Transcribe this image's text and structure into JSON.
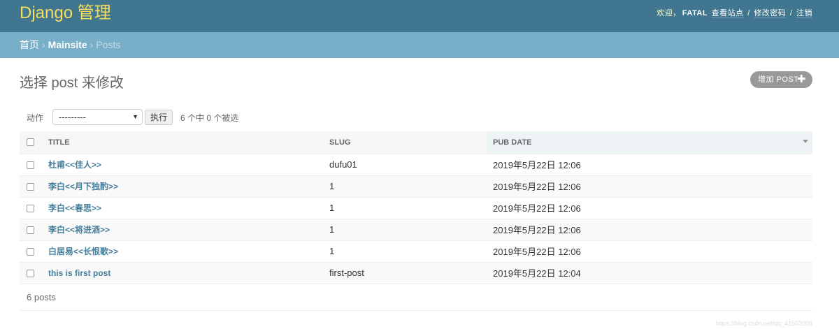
{
  "header": {
    "title": "Django 管理",
    "welcome": "欢迎，",
    "username": "FATAL",
    "links": [
      "查看站点",
      "修改密码",
      "注销"
    ],
    "separator": "/"
  },
  "breadcrumbs": {
    "items": [
      "首页",
      "Mainsite",
      "Posts"
    ],
    "separator": "›"
  },
  "page": {
    "title": "选择 post 来修改",
    "add_button": "增加 POST",
    "add_icon": "plus-icon"
  },
  "actions": {
    "label": "动作",
    "select_value": "---------",
    "go_button": "执行",
    "counter": "6 个中 0 个被选"
  },
  "table": {
    "columns": [
      "TITLE",
      "SLUG",
      "PUB DATE"
    ],
    "rows": [
      {
        "title": "杜甫<<佳人>>",
        "slug": "dufu01",
        "pub_date": "2019年5月22日 12:06"
      },
      {
        "title": "李白<<月下独酌>>",
        "slug": "1",
        "pub_date": "2019年5月22日 12:06"
      },
      {
        "title": "李白<<春思>>",
        "slug": "1",
        "pub_date": "2019年5月22日 12:06"
      },
      {
        "title": "李白<<将进酒>>",
        "slug": "1",
        "pub_date": "2019年5月22日 12:06"
      },
      {
        "title": "白居易<<长恨歌>>",
        "slug": "1",
        "pub_date": "2019年5月22日 12:06"
      },
      {
        "title": "this is first post",
        "slug": "first-post",
        "pub_date": "2019年5月22日 12:04"
      }
    ]
  },
  "paginator": {
    "text": "6 posts"
  },
  "watermark": "https://blog.csdn.net/qq_41502009",
  "colors": {
    "header_bg": "#417690",
    "brand": "#f5dd5d",
    "breadcrumb_bg": "#79aec8",
    "link": "#447e9b"
  }
}
